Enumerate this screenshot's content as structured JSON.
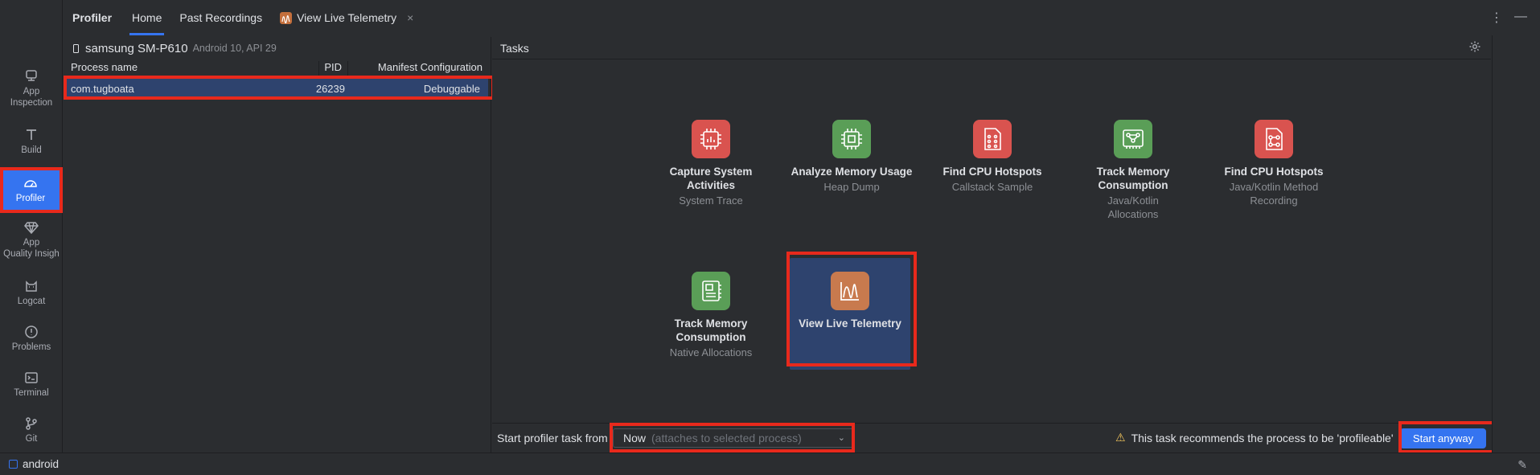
{
  "toolstrip": {
    "items": [
      {
        "label": "App Inspection",
        "icon": "app-inspection-icon"
      },
      {
        "label": "Build",
        "icon": "build-hammer-icon"
      },
      {
        "label": "Profiler",
        "icon": "profiler-gauge-icon"
      },
      {
        "label": "App Quality Insights",
        "icon": "gem-icon"
      },
      {
        "label": "Logcat",
        "icon": "logcat-cat-icon"
      },
      {
        "label": "Problems",
        "icon": "problems-exclamation-icon"
      },
      {
        "label": "Terminal",
        "icon": "terminal-icon"
      },
      {
        "label": "Git",
        "icon": "git-branch-icon"
      }
    ],
    "item_labels": {
      "app_inspection": "App\nInspection",
      "build": "Build",
      "profiler": "Profiler",
      "aqi": "App\nQuality Insigh",
      "logcat": "Logcat",
      "problems": "Problems",
      "terminal": "Terminal",
      "git": "Git"
    }
  },
  "header": {
    "title": "Profiler",
    "tabs": [
      {
        "label": "Home"
      },
      {
        "label": "Past Recordings"
      },
      {
        "label": "View Live Telemetry"
      }
    ],
    "close_glyph": "×"
  },
  "device": {
    "name": "samsung SM-P610",
    "sub": "Android 10, API 29"
  },
  "process_table": {
    "columns": [
      "Process name",
      "PID",
      "Manifest Configuration"
    ],
    "rows": [
      {
        "name": "com.tugboata",
        "pid": "26239",
        "config": "Debuggable"
      }
    ]
  },
  "tasks": {
    "title": "Tasks",
    "items": [
      {
        "title": "Capture System Activities",
        "subtitle": "System Trace",
        "icon": "chip-red-icon"
      },
      {
        "title": "Analyze Memory Usage",
        "subtitle": "Heap Dump",
        "icon": "chip-green-icon"
      },
      {
        "title": "Find CPU Hotspots",
        "subtitle": "Callstack Sample",
        "icon": "document-dots-red-icon"
      },
      {
        "title": "Track Memory Consumption",
        "subtitle": "Java/Kotlin Allocations",
        "icon": "memory-green-icon"
      },
      {
        "title": "Find CPU Hotspots",
        "subtitle": "Java/Kotlin Method Recording",
        "icon": "document-tree-red-icon"
      },
      {
        "title": "Track Memory Consumption",
        "subtitle": "Native Allocations",
        "icon": "memory-green-icon"
      },
      {
        "title": "View Live Telemetry",
        "subtitle": "",
        "icon": "telemetry-wave-icon"
      }
    ]
  },
  "bottom": {
    "start_label": "Start profiler task from",
    "dropdown_value": "Now",
    "dropdown_hint": "(attaches to selected process)",
    "warning": "This task recommends the process to be 'profileable'",
    "start_button": "Start anyway"
  },
  "status": {
    "project": "android"
  },
  "colors": {
    "accent": "#3574f0",
    "selection": "#2e436e",
    "highlight_box": "#e8291c",
    "task_red": "#d9534f",
    "task_green": "#5a9e57",
    "task_orange": "#c87a4e"
  }
}
